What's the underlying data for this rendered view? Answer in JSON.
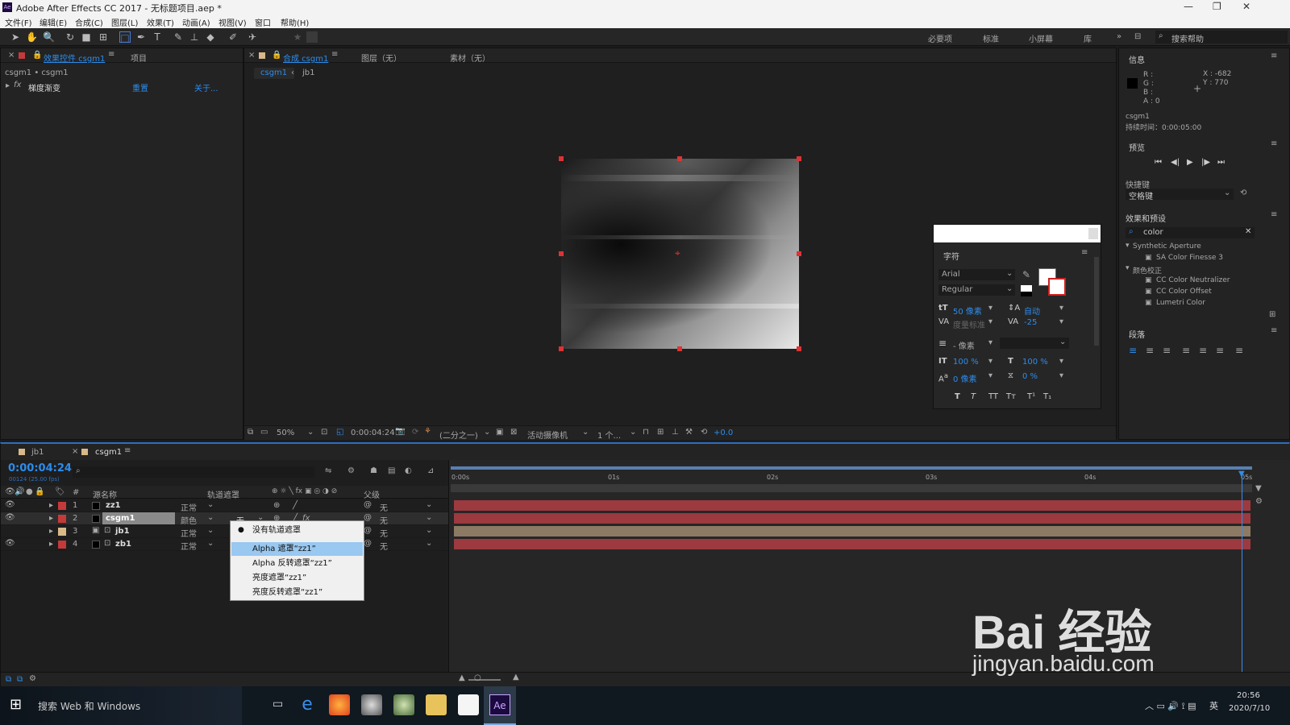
{
  "window": {
    "title": "Adobe After Effects CC 2017 - 无标题项目.aep *",
    "min": "—",
    "max": "❐",
    "close": "✕"
  },
  "menu": [
    "文件(F)",
    "编辑(E)",
    "合成(C)",
    "图层(L)",
    "效果(T)",
    "动画(A)",
    "视图(V)",
    "窗口",
    "帮助(H)"
  ],
  "workspaces": [
    "必要项",
    "标准",
    "小屏幕",
    "库"
  ],
  "search_help": "搜索帮助",
  "effects_panel": {
    "tab": "效果控件 csgm1",
    "tab2": "项目",
    "path": "csgm1 • csgm1",
    "effect": "梯度渐变",
    "reset": "重置",
    "about": "关于..."
  },
  "comp_panel": {
    "tab": "合成 csgm1",
    "layer_tab": "图层（无）",
    "footage_tab": "素材（无）",
    "crumb1": "csgm1",
    "crumb2": "jb1",
    "zoom": "50%",
    "time": "0:00:04:24",
    "res": "(二分之一)",
    "camera": "活动摄像机",
    "views": "1 个...",
    "exposure": "+0.0"
  },
  "info": {
    "title": "信息",
    "rgba": [
      "R :",
      "G :",
      "B :",
      "A : 0"
    ],
    "x": "X : -682",
    "y": "Y : 770",
    "name": "csgm1",
    "dur": "持续时间：0:00:05:00"
  },
  "preview": {
    "title": "预览",
    "shortcut_label": "快捷键",
    "shortcut": "空格键"
  },
  "effects_presets": {
    "title": "效果和预设",
    "search": "color",
    "group1": "Synthetic Aperture",
    "g1items": [
      "SA Color Finesse 3"
    ],
    "group2": "颜色校正",
    "g2items": [
      "CC Color Neutralizer",
      "CC Color Offset",
      "Lumetri Color"
    ]
  },
  "paragraph": {
    "title": "段落"
  },
  "character": {
    "title": "字符",
    "font": "Arial",
    "style": "Regular",
    "size": "50 像素",
    "leading": "自动",
    "kern": "度量标准",
    "tracking": "-25",
    "stroke": "- 像素",
    "vscale": "100 %",
    "hscale": "100 %",
    "baseline": "0 像素",
    "tsume": "0 %",
    "styles": [
      "T",
      "T",
      "TT",
      "Tт",
      "T¹",
      "T₁"
    ]
  },
  "timeline": {
    "tab1": "jb1",
    "tab2": "csgm1",
    "time": "0:00:04:24",
    "fps": "00124 (25.00 fps)",
    "headers": {
      "num": "#",
      "name": "源名称",
      "trkmat": "轨道遮罩",
      "parent": "父级"
    },
    "ruler": [
      "0:00s",
      "01s",
      "02s",
      "03s",
      "04s",
      "05s"
    ],
    "layers": [
      {
        "n": "1",
        "name": "zz1",
        "mode": "正常",
        "parent": "无",
        "color": "#c43a3a"
      },
      {
        "n": "2",
        "name": "csgm1",
        "mode": "颜色",
        "trk": "无",
        "parent": "无",
        "color": "#c43a3a"
      },
      {
        "n": "3",
        "name": "jb1",
        "mode": "正常",
        "parent": "无",
        "color": "#d8b98a"
      },
      {
        "n": "4",
        "name": "zb1",
        "mode": "正常",
        "parent": "无",
        "color": "#c43a3a"
      }
    ]
  },
  "dropdown": [
    "没有轨道遮罩",
    "Alpha 遮罩“zz1”",
    "Alpha 反转遮罩“zz1”",
    "亮度遮罩“zz1”",
    "亮度反转遮罩“zz1”"
  ],
  "watermark": {
    "text": "Bai 经验",
    "url": "jingyan.baidu.com"
  },
  "taskbar": {
    "search": "搜索 Web 和 Windows",
    "time": "20:56",
    "date": "2020/7/10",
    "ime": "英"
  }
}
